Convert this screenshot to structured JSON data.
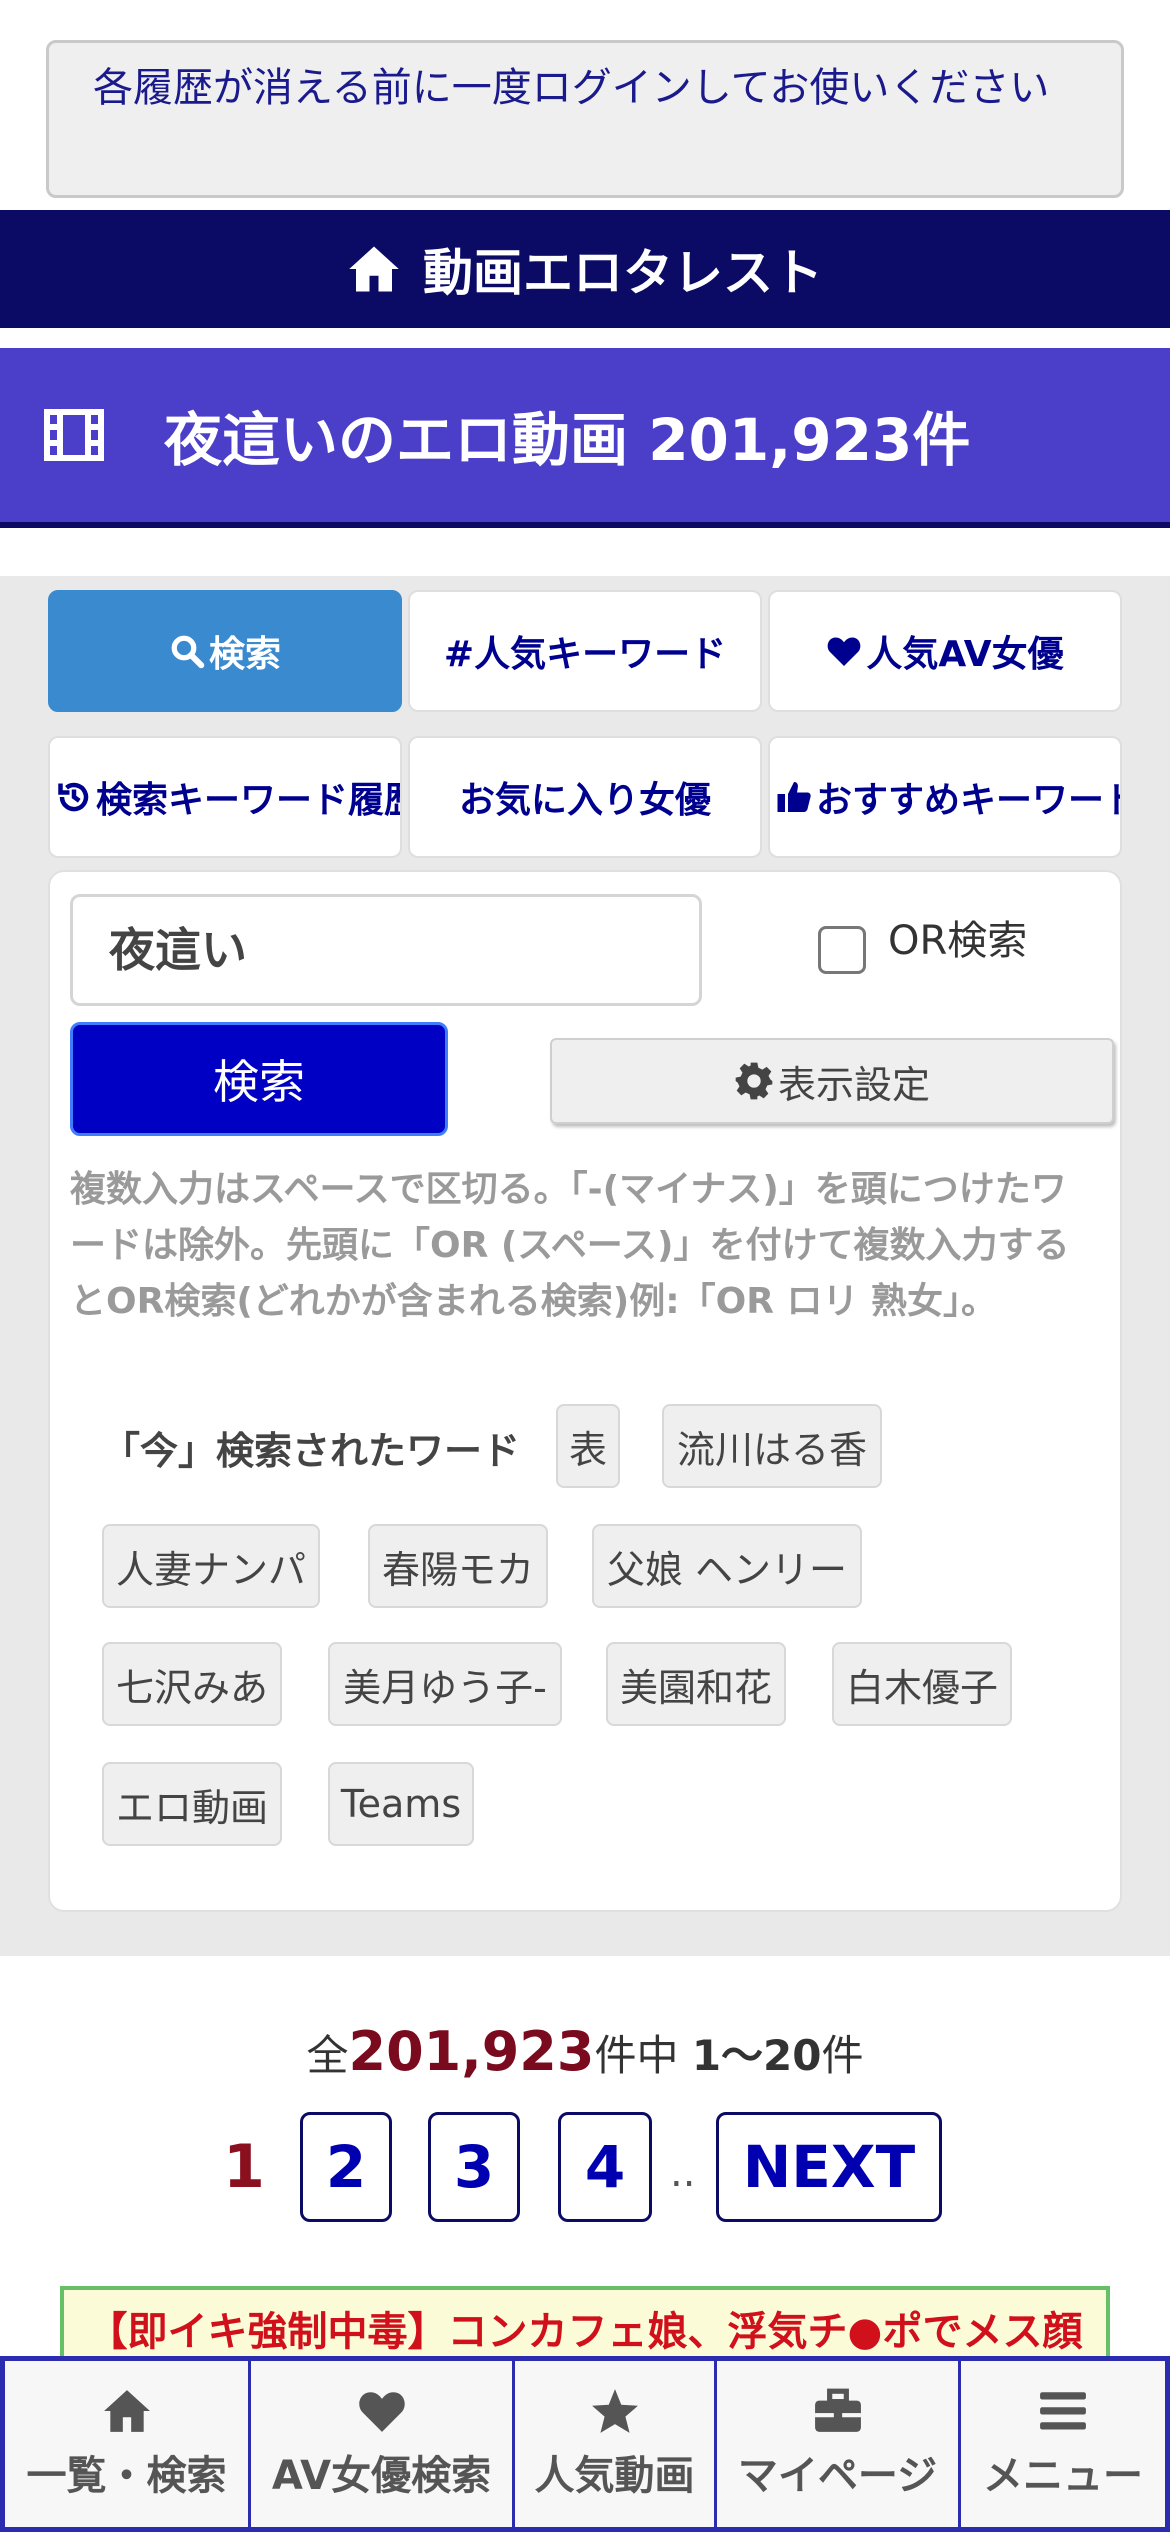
{
  "notice": {
    "text": "各履歴が消える前に一度ログインしてお使いください"
  },
  "header": {
    "title": "動画エロタレスト",
    "icon": "home-icon"
  },
  "page_title": {
    "text": "夜這いのエロ動画 201,923件",
    "icon": "film-icon"
  },
  "tabs": [
    {
      "label": "検索",
      "icon": "search-icon",
      "active": true
    },
    {
      "label": "#人気キーワード",
      "icon": "",
      "active": false
    },
    {
      "label": "人気AV女優",
      "icon": "heart-icon",
      "active": false
    },
    {
      "label": "検索キーワード履歴",
      "icon": "history-icon",
      "active": false
    },
    {
      "label": "お気に入り女優",
      "icon": "",
      "active": false
    },
    {
      "label": "おすすめキーワード",
      "icon": "thumbs-up-icon",
      "active": false
    }
  ],
  "search": {
    "input_value": "夜這い",
    "or_label": "OR検索",
    "or_checked": false,
    "button_label": "検索",
    "settings_label": "表示設定",
    "help_text": "複数入力はスペースで区切る。「-(マイナス)」を頭につけたワードは除外。先頭に「OR (スペース)」を付けて複数入力するとOR検索(どれかが含まれる検索)例:「OR ロリ 熟女」。"
  },
  "trending": {
    "label": "「今」検索されたワード",
    "words": [
      "表",
      "流川はる香",
      "人妻ナンパ",
      "春陽モカ",
      "父娘 ヘンリー",
      "七沢みあ",
      "美月ゆう子-",
      "美園和花",
      "白木優子",
      "エロ動画",
      "Teams"
    ]
  },
  "results": {
    "prefix": "全",
    "total": "201,923",
    "middle": "件中 ",
    "range": "1〜20",
    "suffix": "件"
  },
  "pagination": {
    "current": "1",
    "pages": [
      "2",
      "3",
      "4"
    ],
    "dots": "..",
    "next": "NEXT"
  },
  "promo": {
    "text": "【即イキ強制中毒】コンカフェ娘、浮気チ●ポでメス顔"
  },
  "bottom_nav": [
    {
      "label": "一覧・検索",
      "icon": "home-icon"
    },
    {
      "label": "AV女優検索",
      "icon": "heart-icon"
    },
    {
      "label": "人気動画",
      "icon": "star-icon"
    },
    {
      "label": "マイページ",
      "icon": "briefcase-icon"
    },
    {
      "label": "メニュー",
      "icon": "menu-icon"
    }
  ],
  "colors": {
    "header_bg": "#0b0b66",
    "title_bg": "#4b3fc9",
    "active_tab": "#3a8ad0",
    "search_button": "#0000c4",
    "count_accent": "#7a0a1e",
    "promo_text": "#d0101a"
  }
}
